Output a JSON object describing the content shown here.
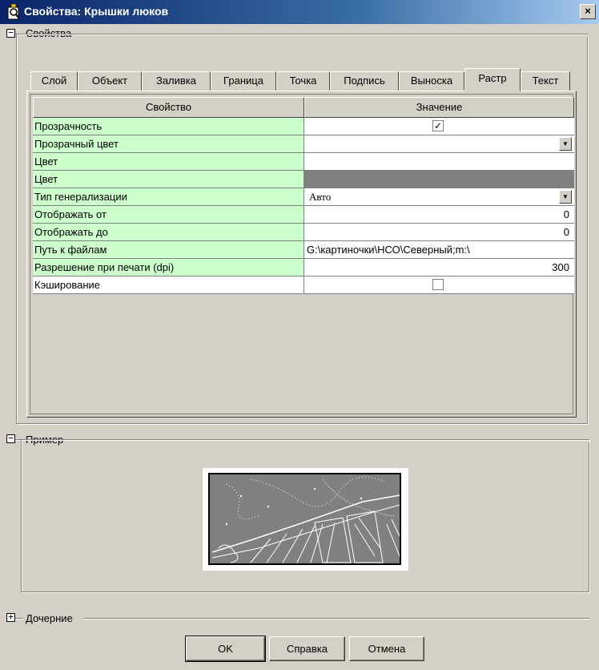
{
  "window": {
    "title": "Свойства: Крышки люков"
  },
  "groups": {
    "properties": "Свойства",
    "example": "Пример",
    "children": "Дочерние"
  },
  "tabs": [
    {
      "label": "Слой"
    },
    {
      "label": "Объект"
    },
    {
      "label": "Заливка"
    },
    {
      "label": "Граница"
    },
    {
      "label": "Точка"
    },
    {
      "label": "Подпись"
    },
    {
      "label": "Выноска"
    },
    {
      "label": "Растр",
      "active": true
    },
    {
      "label": "Текст"
    }
  ],
  "grid": {
    "headers": {
      "property": "Свойство",
      "value": "Значение"
    },
    "rows": [
      {
        "name": "Прозрачность",
        "value": "",
        "checkbox": true,
        "checked": true
      },
      {
        "name": "Прозрачный цвет",
        "value": "",
        "dropdown": true
      },
      {
        "name": "Цвет",
        "value": ""
      },
      {
        "name": "Цвет",
        "value": "",
        "swatch": "#808080"
      },
      {
        "name": "Тип генерализации",
        "value": "Авто",
        "dropdown": true
      },
      {
        "name": "Отображать от",
        "value": "0"
      },
      {
        "name": "Отображать до",
        "value": "0"
      },
      {
        "name": "Путь к файлам",
        "value": "G:\\картиночки\\НСО\\Северный;m:\\"
      },
      {
        "name": "Разрешение при печати (dpi)",
        "value": "300"
      },
      {
        "name": "Кэширование",
        "value": "",
        "checkbox": true,
        "checked": false,
        "plain": true
      }
    ]
  },
  "buttons": {
    "ok": "OK",
    "help": "Справка",
    "cancel": "Отмена"
  },
  "toggles": {
    "expanded": "−",
    "collapsed": "+"
  },
  "marks": {
    "check": "✓",
    "dropdown_arrow": "▼",
    "close": "×"
  },
  "colors": {
    "name_cell": "#ccffcc",
    "swatch": "#808080",
    "preview": "#808080"
  }
}
